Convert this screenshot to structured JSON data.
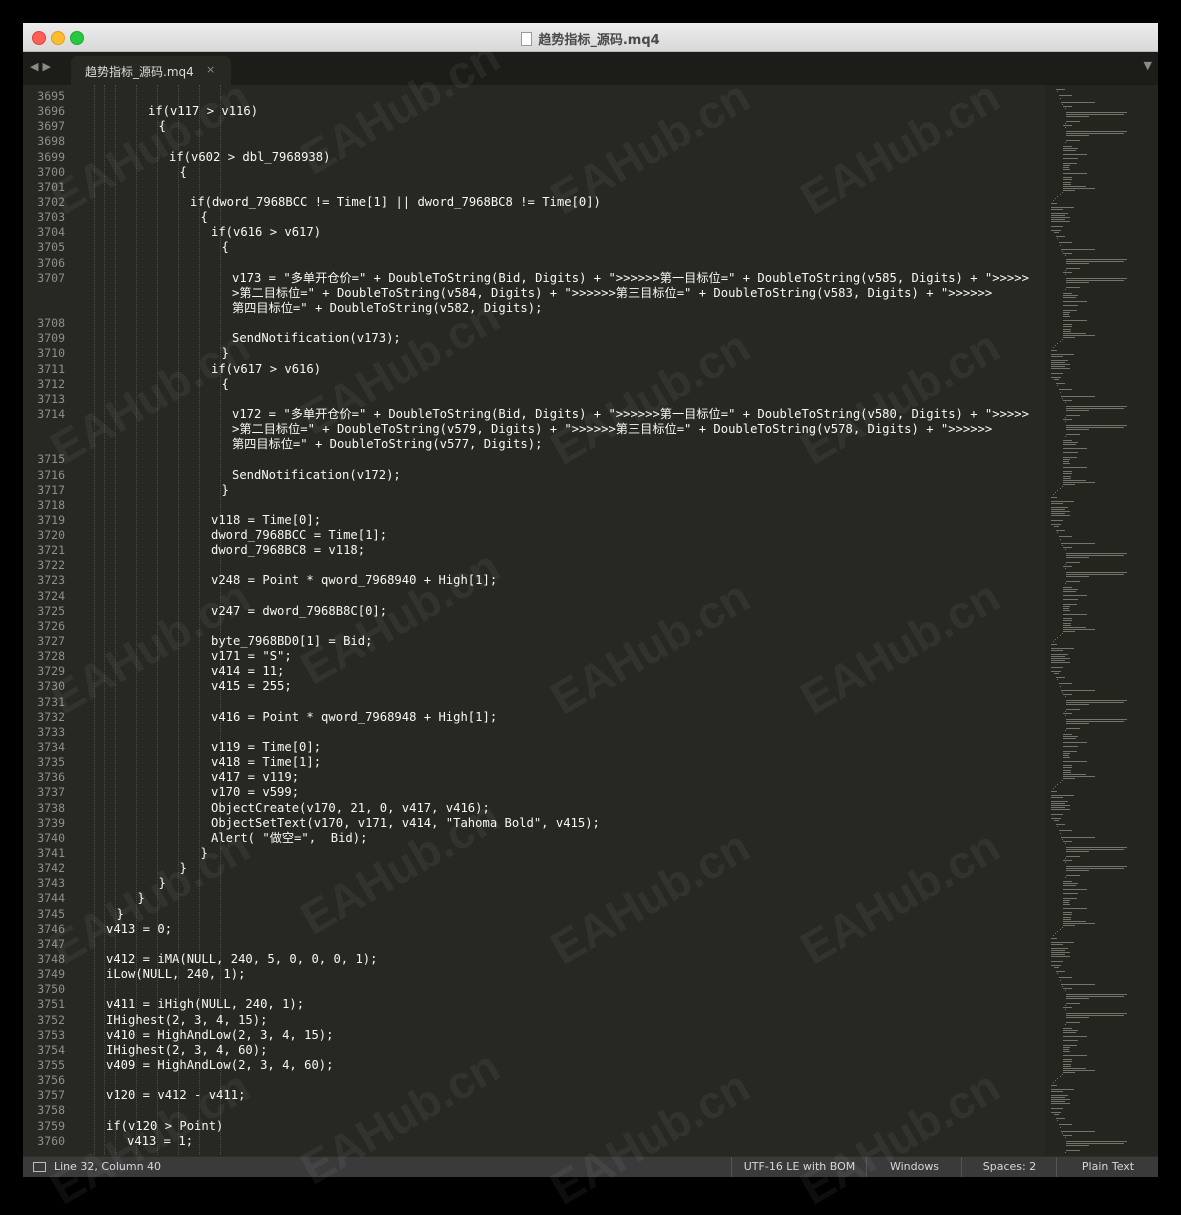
{
  "window": {
    "title": "趋势指标_源码.mq4"
  },
  "tabs": [
    {
      "label": "趋势指标_源码.mq4",
      "close": "×"
    }
  ],
  "tabbar": {
    "back": "◀",
    "forward": "▶",
    "dropdown": "▼"
  },
  "editor": {
    "first_line": 3695,
    "rows": [
      [
        3695,
        0,
        ""
      ],
      [
        3696,
        6,
        "if(v117 > v116)"
      ],
      [
        3697,
        7,
        "{"
      ],
      [
        3698,
        0,
        ""
      ],
      [
        3699,
        8,
        "if(v602 > dbl_7968938)"
      ],
      [
        3700,
        9,
        "{"
      ],
      [
        3701,
        0,
        ""
      ],
      [
        3702,
        10,
        "if(dword_7968BCC != Time[1] || dword_7968BC8 != Time[0])"
      ],
      [
        3703,
        11,
        "{"
      ],
      [
        3704,
        12,
        "if(v616 > v617)"
      ],
      [
        3705,
        13,
        "{"
      ],
      [
        3706,
        0,
        ""
      ],
      [
        3707,
        14,
        "v173 = \"多单开仓价=\" + DoubleToString(Bid, Digits) + \">>>>>>第一目标位=\" + DoubleToString(v585, Digits) + \">>>>>"
      ],
      [
        null,
        14,
        ">第二目标位=\" + DoubleToString(v584, Digits) + \">>>>>>第三目标位=\" + DoubleToString(v583, Digits) + \">>>>>>"
      ],
      [
        null,
        14,
        "第四目标位=\" + DoubleToString(v582, Digits);"
      ],
      [
        3708,
        0,
        ""
      ],
      [
        3709,
        14,
        "SendNotification(v173);"
      ],
      [
        3710,
        13,
        "}"
      ],
      [
        3711,
        12,
        "if(v617 > v616)"
      ],
      [
        3712,
        13,
        "{"
      ],
      [
        3713,
        0,
        ""
      ],
      [
        3714,
        14,
        "v172 = \"多单开仓价=\" + DoubleToString(Bid, Digits) + \">>>>>>第一目标位=\" + DoubleToString(v580, Digits) + \">>>>>"
      ],
      [
        null,
        14,
        ">第二目标位=\" + DoubleToString(v579, Digits) + \">>>>>>第三目标位=\" + DoubleToString(v578, Digits) + \">>>>>>"
      ],
      [
        null,
        14,
        "第四目标位=\" + DoubleToString(v577, Digits);"
      ],
      [
        3715,
        0,
        ""
      ],
      [
        3716,
        14,
        "SendNotification(v172);"
      ],
      [
        3717,
        13,
        "}"
      ],
      [
        3718,
        0,
        ""
      ],
      [
        3719,
        12,
        "v118 = Time[0];"
      ],
      [
        3720,
        12,
        "dword_7968BCC = Time[1];"
      ],
      [
        3721,
        12,
        "dword_7968BC8 = v118;"
      ],
      [
        3722,
        0,
        ""
      ],
      [
        3723,
        12,
        "v248 = Point * qword_7968940 + High[1];"
      ],
      [
        3724,
        0,
        ""
      ],
      [
        3725,
        12,
        "v247 = dword_7968B8C[0];"
      ],
      [
        3726,
        0,
        ""
      ],
      [
        3727,
        12,
        "byte_7968BD0[1] = Bid;"
      ],
      [
        3728,
        12,
        "v171 = \"S\";"
      ],
      [
        3729,
        12,
        "v414 = 11;"
      ],
      [
        3730,
        12,
        "v415 = 255;"
      ],
      [
        3731,
        0,
        ""
      ],
      [
        3732,
        12,
        "v416 = Point * qword_7968948 + High[1];"
      ],
      [
        3733,
        0,
        ""
      ],
      [
        3734,
        12,
        "v119 = Time[0];"
      ],
      [
        3735,
        12,
        "v418 = Time[1];"
      ],
      [
        3736,
        12,
        "v417 = v119;"
      ],
      [
        3737,
        12,
        "v170 = v599;"
      ],
      [
        3738,
        12,
        "ObjectCreate(v170, 21, 0, v417, v416);"
      ],
      [
        3739,
        12,
        "ObjectSetText(v170, v171, v414, \"Tahoma Bold\", v415);"
      ],
      [
        3740,
        12,
        "Alert( \"做空=\",  Bid);"
      ],
      [
        3741,
        11,
        "}"
      ],
      [
        3742,
        9,
        "}"
      ],
      [
        3743,
        7,
        "}"
      ],
      [
        3744,
        5,
        "}"
      ],
      [
        3745,
        3,
        "}"
      ],
      [
        3746,
        2,
        "v413 = 0;"
      ],
      [
        3747,
        0,
        ""
      ],
      [
        3748,
        2,
        "v412 = iMA(NULL, 240, 5, 0, 0, 0, 1);"
      ],
      [
        3749,
        2,
        "iLow(NULL, 240, 1);"
      ],
      [
        3750,
        0,
        ""
      ],
      [
        3751,
        2,
        "v411 = iHigh(NULL, 240, 1);"
      ],
      [
        3752,
        2,
        "IHighest(2, 3, 4, 15);"
      ],
      [
        3753,
        2,
        "v410 = HighAndLow(2, 3, 4, 15);"
      ],
      [
        3754,
        2,
        "IHighest(2, 3, 4, 60);"
      ],
      [
        3755,
        2,
        "v409 = HighAndLow(2, 3, 4, 60);"
      ],
      [
        3756,
        0,
        ""
      ],
      [
        3757,
        2,
        "v120 = v412 - v411;"
      ],
      [
        3758,
        0,
        ""
      ],
      [
        3759,
        2,
        "if(v120 > Point)"
      ],
      [
        3760,
        4,
        "v413 = 1;"
      ]
    ]
  },
  "status": {
    "position": "Line 32, Column 40",
    "encoding": "UTF-16 LE with BOM",
    "line_endings": "Windows",
    "indentation": "Spaces: 2",
    "syntax": "Plain Text"
  },
  "watermark": "EAHub.cn"
}
